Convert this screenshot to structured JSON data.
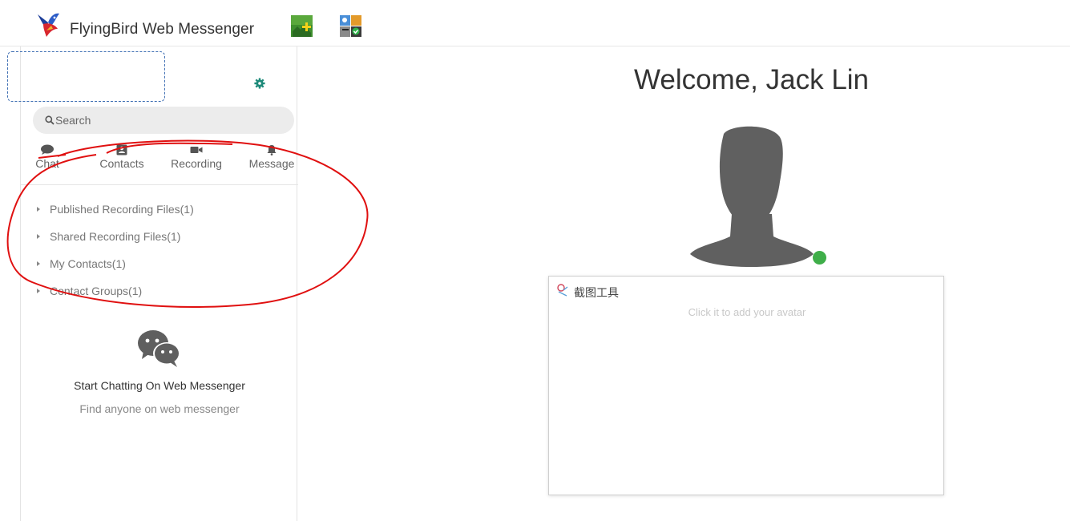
{
  "app": {
    "title": "FlyingBird Web Messenger"
  },
  "search": {
    "placeholder": "Search"
  },
  "tabs": [
    {
      "label": "Chat",
      "icon": "chat-bubble-icon"
    },
    {
      "label": "Contacts",
      "icon": "contact-card-icon"
    },
    {
      "label": "Recording",
      "icon": "video-camera-icon"
    },
    {
      "label": "Message",
      "icon": "bell-icon"
    }
  ],
  "tree": [
    {
      "label": "Published Recording Files(1)"
    },
    {
      "label": "Shared Recording Files(1)"
    },
    {
      "label": "My Contacts(1)"
    },
    {
      "label": "Contact Groups(1)"
    }
  ],
  "empty_state": {
    "title": "Start Chatting On Web Messenger",
    "subtitle": "Find anyone on web messenger"
  },
  "main": {
    "welcome": "Welcome, Jack Lin",
    "status_color": "#3fae49",
    "popup_title": "截图工具",
    "avatar_hint": "Click it to add your avatar"
  },
  "colors": {
    "accent": "#1e8a7a",
    "annotation": "#e01010",
    "icon_gray": "#555555"
  }
}
